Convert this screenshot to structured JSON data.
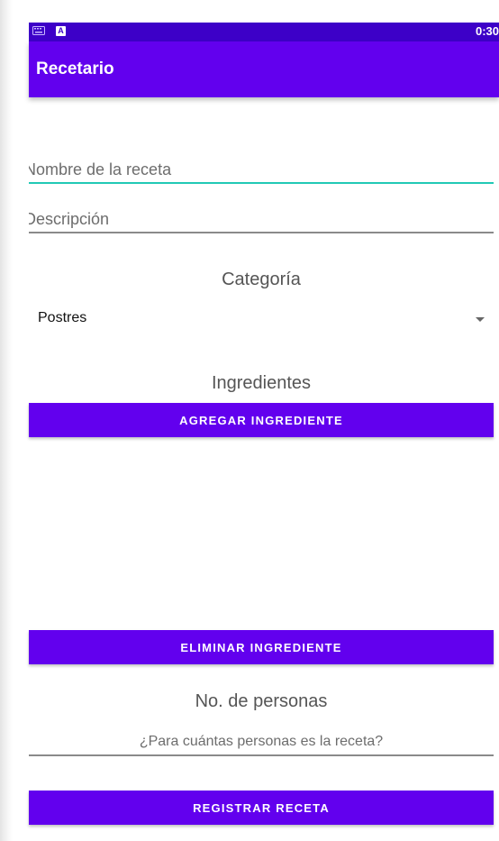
{
  "colors": {
    "status_bar": "#3d00c8",
    "primary": "#6200ee",
    "focus": "#21c9b5"
  },
  "status_bar": {
    "time": "0:30",
    "icons": [
      "keyboard-icon",
      "a-notification-icon"
    ],
    "a_icon_letter": "A"
  },
  "app_bar": {
    "title": "Recetario"
  },
  "form": {
    "recipe_name": {
      "value": "",
      "placeholder": "Nombre de la receta"
    },
    "description": {
      "value": "",
      "placeholder": "Descripción"
    },
    "category_label": "Categoría",
    "category_selected": "Postres",
    "ingredients_label": "Ingredientes",
    "add_ingredient_button": "AGREGAR INGREDIENTE",
    "ingredients": [],
    "remove_ingredient_button": "ELIMINAR INGREDIENTE",
    "servings_label": "No. de personas",
    "servings": {
      "value": "",
      "placeholder": "¿Para cuántas personas es la receta?"
    },
    "submit_button": "REGISTRAR RECETA"
  }
}
